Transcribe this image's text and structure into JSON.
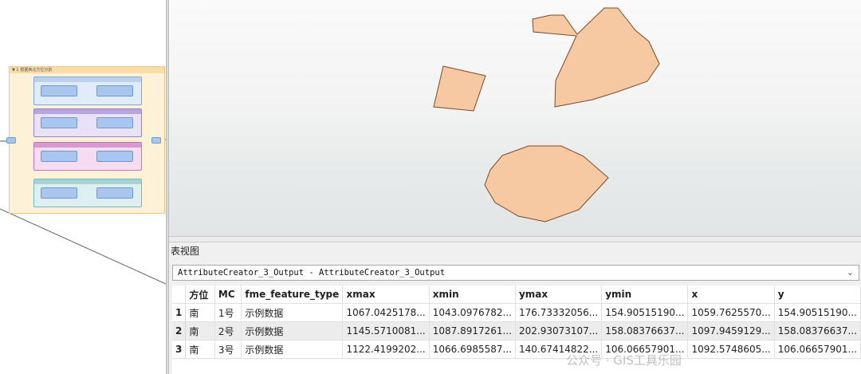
{
  "table_panel": {
    "title": "表视图",
    "selector_value": "AttributeCreator_3_Output - AttributeCreator_3_Output",
    "columns": [
      "方位",
      "MC",
      "fme_feature_type",
      "xmax",
      "xmin",
      "ymax",
      "ymin",
      "x",
      "y"
    ],
    "rows": [
      {
        "num": "1",
        "cells": [
          "南",
          "1号",
          "示例数据",
          "1067.0425178...",
          "1043.0976782...",
          "176.73332056...",
          "154.90515190...",
          "1059.7625570...",
          "154.90515190..."
        ]
      },
      {
        "num": "2",
        "cells": [
          "南",
          "2号",
          "示例数据",
          "1145.5710081...",
          "1087.8917261...",
          "202.93073107...",
          "158.08376637...",
          "1097.9459129...",
          "158.08376637..."
        ]
      },
      {
        "num": "3",
        "cells": [
          "南",
          "3号",
          "示例数据",
          "1122.4199202...",
          "1066.6985587...",
          "140.67414822...",
          "106.06657901...",
          "1092.5748605...",
          "106.06657901..."
        ]
      }
    ]
  },
  "workflow": {
    "bookmark_title": "▼ 1 根据西北方位分割"
  },
  "watermark": "公众号 · GIS工具乐园",
  "colors": {
    "polygon_fill": "#f6c9a2",
    "polygon_stroke": "#7a4a2a",
    "bookmark_fill": "#fdf1d8",
    "selected_row": "#ececec"
  }
}
